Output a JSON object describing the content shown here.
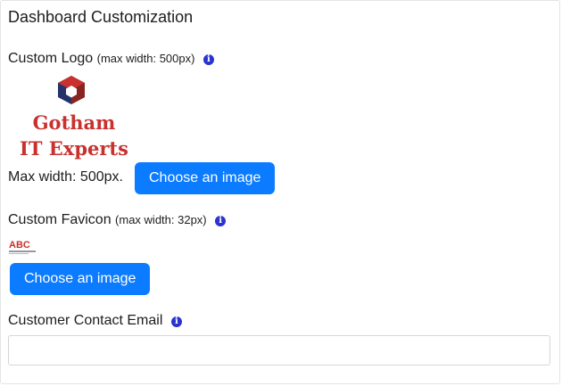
{
  "section": {
    "title": "Dashboard Customization"
  },
  "custom_logo": {
    "label": "Custom Logo",
    "hint": "(max width: 500px)",
    "info_icon": "info-icon",
    "logo_lines": [
      "Gotham",
      "IT Experts"
    ],
    "logo_color": "#c8312e",
    "max_width_text": "Max width: 500px.",
    "button_label": "Choose an image"
  },
  "custom_favicon": {
    "label": "Custom Favicon",
    "hint": "(max width: 32px)",
    "info_icon": "info-icon",
    "favicon_text": "ABC",
    "button_label": "Choose an image"
  },
  "customer_contact_email": {
    "label": "Customer Contact Email",
    "info_icon": "info-icon",
    "value": "",
    "placeholder": ""
  },
  "colors": {
    "button": "#0b7bff",
    "info_icon": "#2a33cf"
  }
}
